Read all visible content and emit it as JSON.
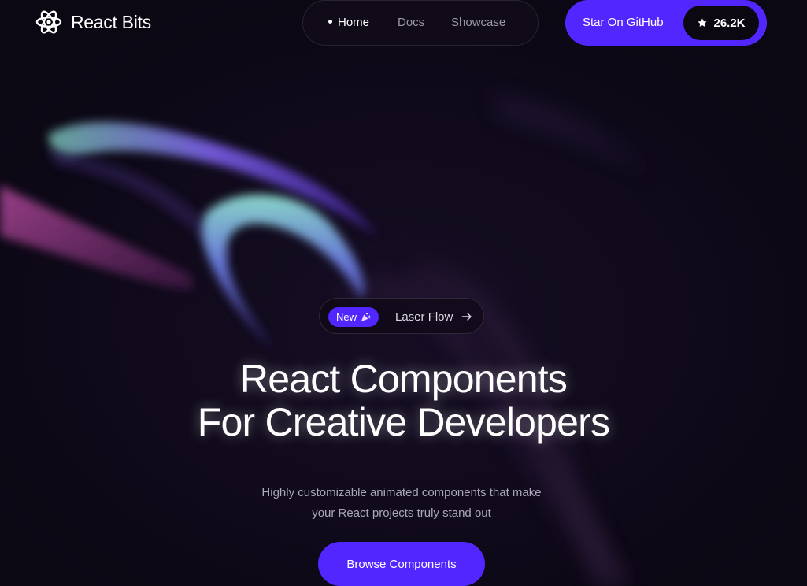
{
  "brand": {
    "name": "React Bits",
    "logo_icon": "atom-icon",
    "accent_color": "#5227ff",
    "background_color": "#0f0918"
  },
  "nav": {
    "items": [
      {
        "label": "Home",
        "active": true
      },
      {
        "label": "Docs",
        "active": false
      },
      {
        "label": "Showcase",
        "active": false
      }
    ]
  },
  "github": {
    "label": "Star On GitHub",
    "star_icon": "star-icon",
    "count": "26.2K"
  },
  "announcement": {
    "badge": "New",
    "badge_icon": "party-popper-icon",
    "text": "Laser Flow",
    "arrow_icon": "arrow-right-icon"
  },
  "hero": {
    "title_line1": "React Components",
    "title_line2": "For Creative Developers",
    "subtitle_line1": "Highly customizable animated components that make",
    "subtitle_line2": "your React projects truly stand out",
    "cta_label": "Browse Components"
  }
}
